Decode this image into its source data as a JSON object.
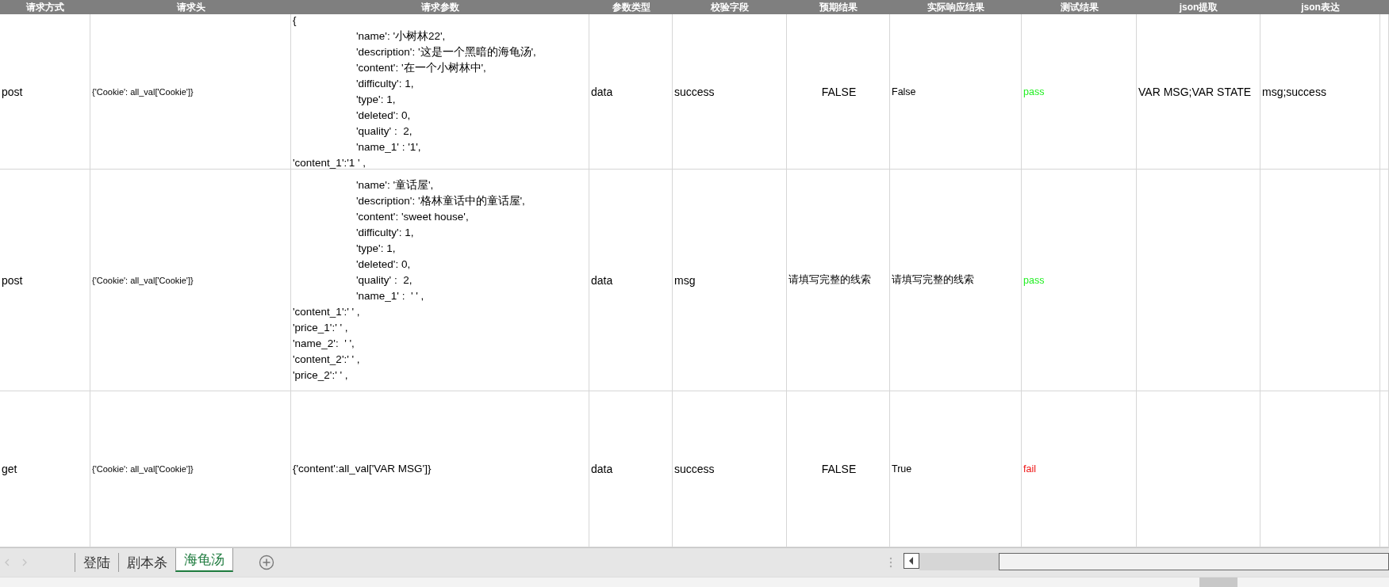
{
  "columns": [
    "请求方式",
    "请求头",
    "请求参数",
    "参数类型",
    "校验字段",
    "预期结果",
    "实际响应结果",
    "测试结果",
    "json提取",
    "json表达"
  ],
  "rows": [
    {
      "method": "post",
      "header": "{'Cookie': all_val['Cookie']}",
      "params": [
        {
          "text": "{",
          "indented": false
        },
        {
          "text": "'name': '小树林22',",
          "indented": true
        },
        {
          "text": "'description': '这是一个黑暗的海龟汤',",
          "indented": true
        },
        {
          "text": "'content': '在一个小树林中',",
          "indented": true
        },
        {
          "text": "'difficulty': 1,",
          "indented": true
        },
        {
          "text": "'type': 1,",
          "indented": true
        },
        {
          "text": "'deleted': 0,",
          "indented": true
        },
        {
          "text": "'quality' :  2,",
          "indented": true
        },
        {
          "text": "'name_1' : '1',",
          "indented": true
        },
        {
          "text": "'content_1':'1 ' ,",
          "indented": false
        }
      ],
      "param_type": "data",
      "check_field": "success",
      "expected": {
        "text": "FALSE",
        "kind": "boolean"
      },
      "actual": "False",
      "test_result": {
        "text": "pass",
        "color": "#22ee22"
      },
      "json_extract": "VAR MSG;VAR STATE",
      "json_expression": "msg;success"
    },
    {
      "method": "post",
      "header": "{'Cookie': all_val['Cookie']}",
      "params": [
        {
          "text": "'name': '童话屋',",
          "indented": true
        },
        {
          "text": "'description': '格林童话中的童话屋',",
          "indented": true
        },
        {
          "text": "'content': 'sweet house',",
          "indented": true
        },
        {
          "text": "'difficulty': 1,",
          "indented": true
        },
        {
          "text": "'type': 1,",
          "indented": true
        },
        {
          "text": "'deleted': 0,",
          "indented": true
        },
        {
          "text": "'quality' :  2,",
          "indented": true
        },
        {
          "text": "'name_1' :  ' ' ,",
          "indented": true
        },
        {
          "text": "'content_1':' ' ,",
          "indented": false
        },
        {
          "text": "'price_1':' ' ,",
          "indented": false
        },
        {
          "text": "'name_2':  ' ',",
          "indented": false
        },
        {
          "text": "'content_2':' ' ,",
          "indented": false
        },
        {
          "text": "'price_2':' ' ,",
          "indented": false
        }
      ],
      "param_type": "data",
      "check_field": "msg",
      "expected": {
        "text": "请填写完整的线索",
        "kind": "text"
      },
      "actual": "请填写完整的线索",
      "test_result": {
        "text": "pass",
        "color": "#22ee22"
      }
    },
    {
      "method": "get",
      "header": "{'Cookie': all_val['Cookie']}",
      "params": [
        {
          "text": "{'content':all_val['VAR MSG']}",
          "indented": false
        }
      ],
      "param_type": "data",
      "check_field": "success",
      "expected": {
        "text": "FALSE",
        "kind": "boolean"
      },
      "actual": "True",
      "test_result": {
        "text": "fail",
        "color": "#ee1111"
      }
    }
  ],
  "sheet_tabs": [
    {
      "label": "登陆",
      "selected": false
    },
    {
      "label": "剧本杀",
      "selected": false
    },
    {
      "label": "海龟汤",
      "selected": true
    }
  ]
}
